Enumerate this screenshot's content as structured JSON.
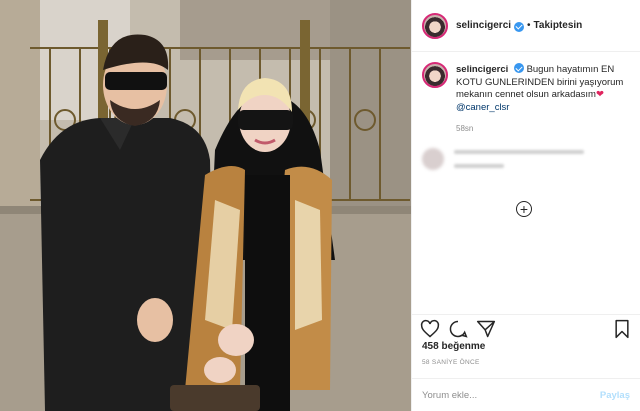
{
  "post": {
    "username": "selincigerci",
    "follow_status": "Takiptesin",
    "separator": "•",
    "caption": {
      "username": "selincigerci",
      "text": "Bugun hayatımın EN KOTU GUNLERINDEN birini yaşıyorum mekanın cennet olsun arkadasım",
      "mention": "@caner_clsr",
      "heart": "❤"
    },
    "caption_age": "58sn",
    "load_more_symbol": "+",
    "likes": "458 beğenme",
    "time_label": "58 SANİYE ÖNCE",
    "add_comment_placeholder": "Yorum ekle...",
    "share_label": "Paylaş"
  },
  "icons": {
    "like": "heart-icon",
    "comment": "comment-icon",
    "share": "send-icon",
    "save": "bookmark-icon",
    "verified": "verified-badge-icon"
  },
  "colors": {
    "verified_blue": "#3897f0",
    "share_disabled": "#b2dffc",
    "muted_text": "#8e8e8e",
    "heart_red": "#e0245e"
  }
}
